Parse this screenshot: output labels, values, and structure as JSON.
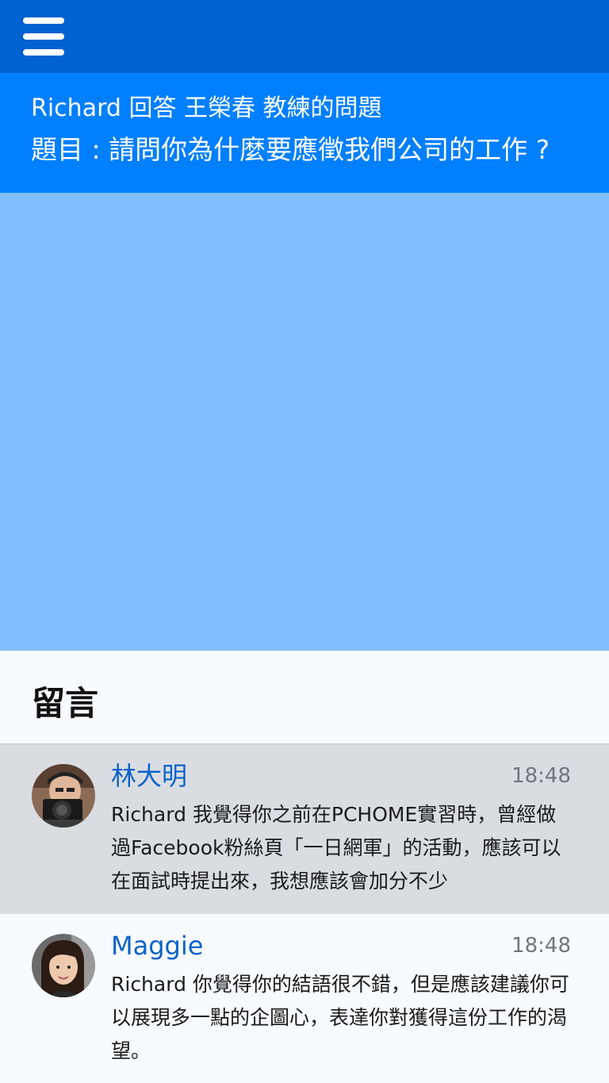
{
  "topbar": {
    "menu_icon": "hamburger-menu-icon",
    "color": "#0062d0"
  },
  "header": {
    "line1": "Richard 回答 王榮春 教練的問題",
    "line2": "題目 : 請問你為什麼要應徵我們公司的工作 ?",
    "color": "#007fff"
  },
  "video": {
    "color": "#80bfff"
  },
  "comments": {
    "title": "留言",
    "items": [
      {
        "name": "林大明",
        "time": "18:48",
        "text": "Richard 我覺得你之前在PCHOME實習時，曾經做過Facebook粉絲頁「一日網軍」的活動，應該可以在面試時提出來，我想應該會加分不少"
      },
      {
        "name": "Maggie",
        "time": "18:48",
        "text": "Richard 你覺得你的結語很不錯，但是應該建議你可以展現多一點的企圖心，表達你對獲得這份工作的渴望。"
      }
    ]
  }
}
